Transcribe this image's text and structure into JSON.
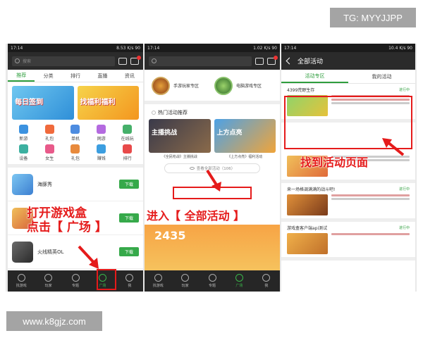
{
  "watermarks": {
    "top_right": "TG: MYYJJPP",
    "bottom_left": "www.k8gjz.com"
  },
  "colors": {
    "accent_green": "#2e9e3d",
    "annotation_red": "#e51b1b",
    "dark_bar": "#2b2b2b"
  },
  "phone1": {
    "status": {
      "time": "17:14",
      "right": "8.53 K/s  90"
    },
    "search_placeholder": "搜索",
    "tabs": [
      "推荐",
      "分类",
      "排行",
      "直播",
      "资讯"
    ],
    "banners": [
      "每日签到",
      "找福利福利"
    ],
    "grid": [
      "新游",
      "礼包",
      "单机",
      "网游",
      "在线玩",
      "设备",
      "女生",
      "礼包",
      "赚钱",
      "排行"
    ],
    "apps": [
      {
        "name": "海豚秀",
        "button": "下载"
      },
      {
        "name": "",
        "button": "下载"
      },
      {
        "name": "火线精英OL",
        "button": "下载"
      }
    ],
    "nav": [
      "找游戏",
      "玩家",
      "专题",
      "广场",
      "我"
    ],
    "annotation": "打开游戏盒\n点击【 广场 】"
  },
  "phone2": {
    "status": {
      "time": "17:14",
      "right": "1.02 K/s  90"
    },
    "featured": [
      {
        "title": "手游玩家专区",
        "subtitle": ""
      },
      {
        "title": "电脑游戏专区",
        "subtitle": ""
      }
    ],
    "section_title": "热门活动推荐",
    "promos": [
      "主播挑战",
      "上方点亮"
    ],
    "promo_captions": [
      "《全民枪战》主播挑战",
      "《上方点亮》福利活动"
    ],
    "all_activities_button": "查看全部活动（106）",
    "count": "2435",
    "nav": [
      "找游戏",
      "玩家",
      "专题",
      "广场",
      "我"
    ],
    "annotation": "进入【 全部活动 】"
  },
  "phone3": {
    "status": {
      "time": "17:14",
      "right": "10.4 K/s  90"
    },
    "title": "全部活动",
    "tabs": [
      "活动专区",
      "我的活动"
    ],
    "activities": [
      {
        "title": "4399荒野生存",
        "status": "进行中"
      },
      {
        "title": "",
        "status": ""
      },
      {
        "title": "来一场格调满满的战斗吧!",
        "status": "进行中"
      },
      {
        "title": "游戏盒客户端api测试",
        "status": "进行中"
      }
    ],
    "annotation": "找到活动页面"
  }
}
